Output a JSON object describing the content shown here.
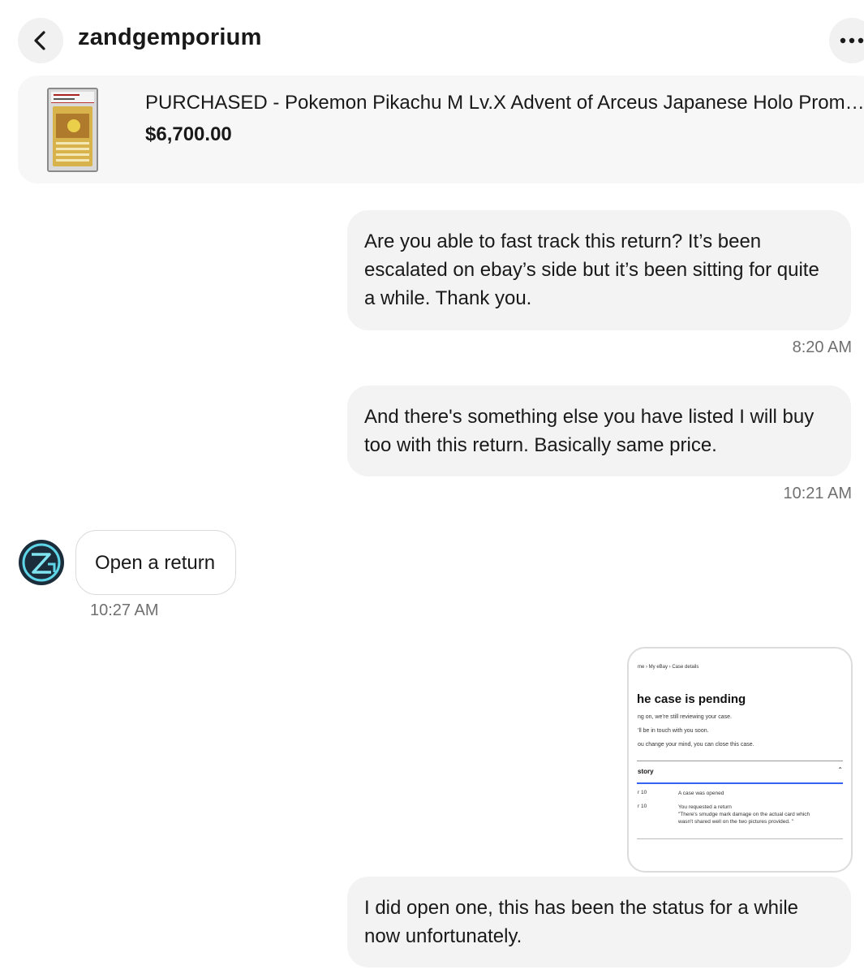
{
  "header": {
    "title": "zandgemporium",
    "back_icon": "chevron-left-icon",
    "more_icon": "more-horizontal-icon"
  },
  "item": {
    "title": "PURCHASED - Pokemon Pikachu M Lv.X Advent of Arceus Japanese Holo Promo PSA",
    "price": "$6,700.00"
  },
  "messages": [
    {
      "direction": "outgoing",
      "lines": [
        "Are you able to fast track this return? It’s been",
        "escalated on ebay’s side but it’s been sitting for quite",
        "a while. Thank you."
      ],
      "time": "8:20 AM"
    },
    {
      "direction": "outgoing",
      "lines": [
        "And there's something else you have listed I will buy",
        "too with this return. Basically same price."
      ],
      "time": "10:21 AM"
    },
    {
      "direction": "incoming",
      "text": "Open a return",
      "time": "10:27 AM"
    },
    {
      "direction": "outgoing",
      "lines": [
        "I did open one, this has been the status for a while",
        "now unfortunately."
      ]
    }
  ],
  "attachment": {
    "breadcrumb": "me  ›  My eBay  ›  Case details",
    "heading": "he case is pending",
    "lines": [
      "ng on, we’re still reviewing your case.",
      "’ll be in touch with you soon.",
      "ou change your mind, you can close this case."
    ],
    "history_label": "story",
    "caret": "⌃",
    "events": [
      {
        "date": "r 10",
        "text": [
          "A case was opened"
        ]
      },
      {
        "date": "r 10",
        "text": [
          "You requested a return",
          "\"There's smudge mark damage on the actual card which",
          "wasn't shared well on the two pictures provided. \""
        ]
      }
    ]
  },
  "colors": {
    "bubble_outgoing": "#f3f3f3",
    "item_card_bg": "#f7f7f7",
    "timestamp": "#707070",
    "avatar_bg": "#1b2c3b",
    "avatar_accent": "#5fd6e8"
  }
}
